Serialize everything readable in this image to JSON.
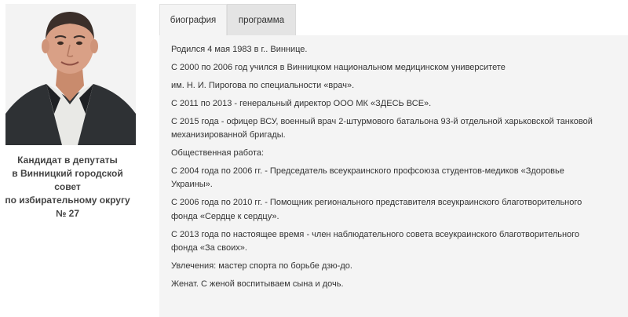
{
  "candidate": {
    "caption_lines": [
      "Кандидат в депутаты",
      "в Винницкий городской совет",
      "по избирательному округу № 27"
    ]
  },
  "tabs": [
    {
      "label": "биография",
      "active": true
    },
    {
      "label": "программа",
      "active": false
    }
  ],
  "biography": {
    "p1": "Родился  4 мая 1983  в г.. Виннице.",
    "p2": "С 2000 по 2006 год  учился в Винницком национальном медицинском университете",
    "p3": "им. Н. И. Пирогова по специальности «врач».",
    "p4": "С 2011 по 2013  - генеральный директор ООО МК «ЗДЕСЬ ВСЕ».",
    "p5": [
      "С 2015 года  - офицер ВСУ, военный врач 2-штурмового батальона 93-й отдельной харьковской танковой",
      "механизированной бригады."
    ],
    "p6": "Общественная работа:",
    "p7": [
      "С 2004 года по 2006 гг.  - Председатель всеукраинского профсоюза студентов-медиков «Здоровье",
      "Украины»."
    ],
    "p8": [
      "С 2006 года по 2010 гг.  - Помощник регионального представителя всеукраинского благотворительного",
      "фонда «Сердце к сердцу»."
    ],
    "p9": [
      "С 2013 года  по настоящее время - член наблюдательного совета всеукраинского благотворительного",
      "фонда «За своих»."
    ],
    "p10": "Увлечения: мастер спорта по борьбе дзю-до.",
    "p11": "Женат. С женой воспитываем сына и дочь."
  }
}
